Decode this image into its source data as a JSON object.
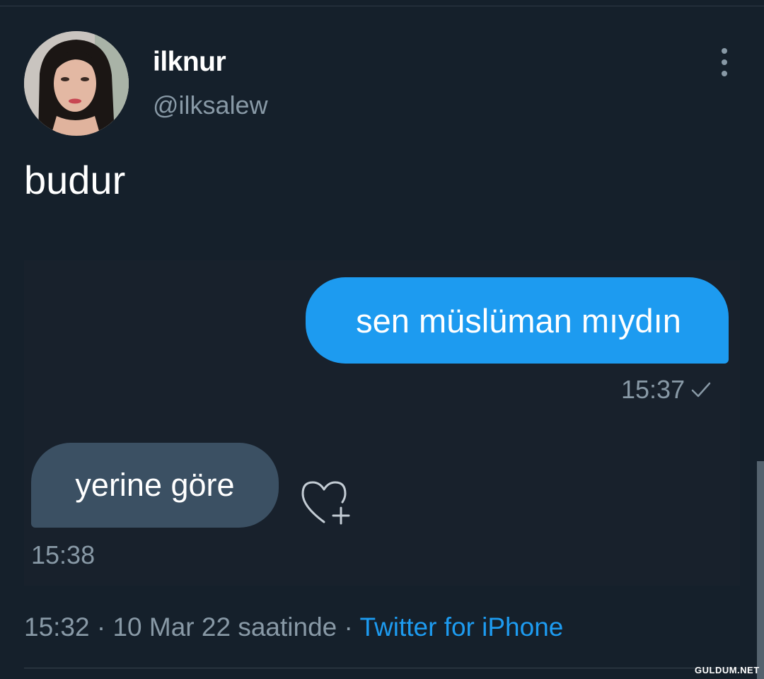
{
  "tweet": {
    "display_name": "ilknur",
    "handle": "@ilksalew",
    "text": "budur"
  },
  "chat": {
    "outgoing": {
      "message": "sen müslüman mıydın",
      "time": "15:37"
    },
    "incoming": {
      "message": "yerine göre",
      "time": "15:38"
    }
  },
  "meta": {
    "timestamp": "15:32 · 10 Mar 22 saatinde · ",
    "source": "Twitter for iPhone"
  },
  "watermark": "GULDUM.NET",
  "colors": {
    "background": "#15202b",
    "accent": "#1d9bf0",
    "secondary_text": "#8899a6",
    "incoming_bubble": "#3b5063"
  },
  "icons": [
    "more-vertical-icon",
    "check-icon",
    "heart-add-icon"
  ]
}
